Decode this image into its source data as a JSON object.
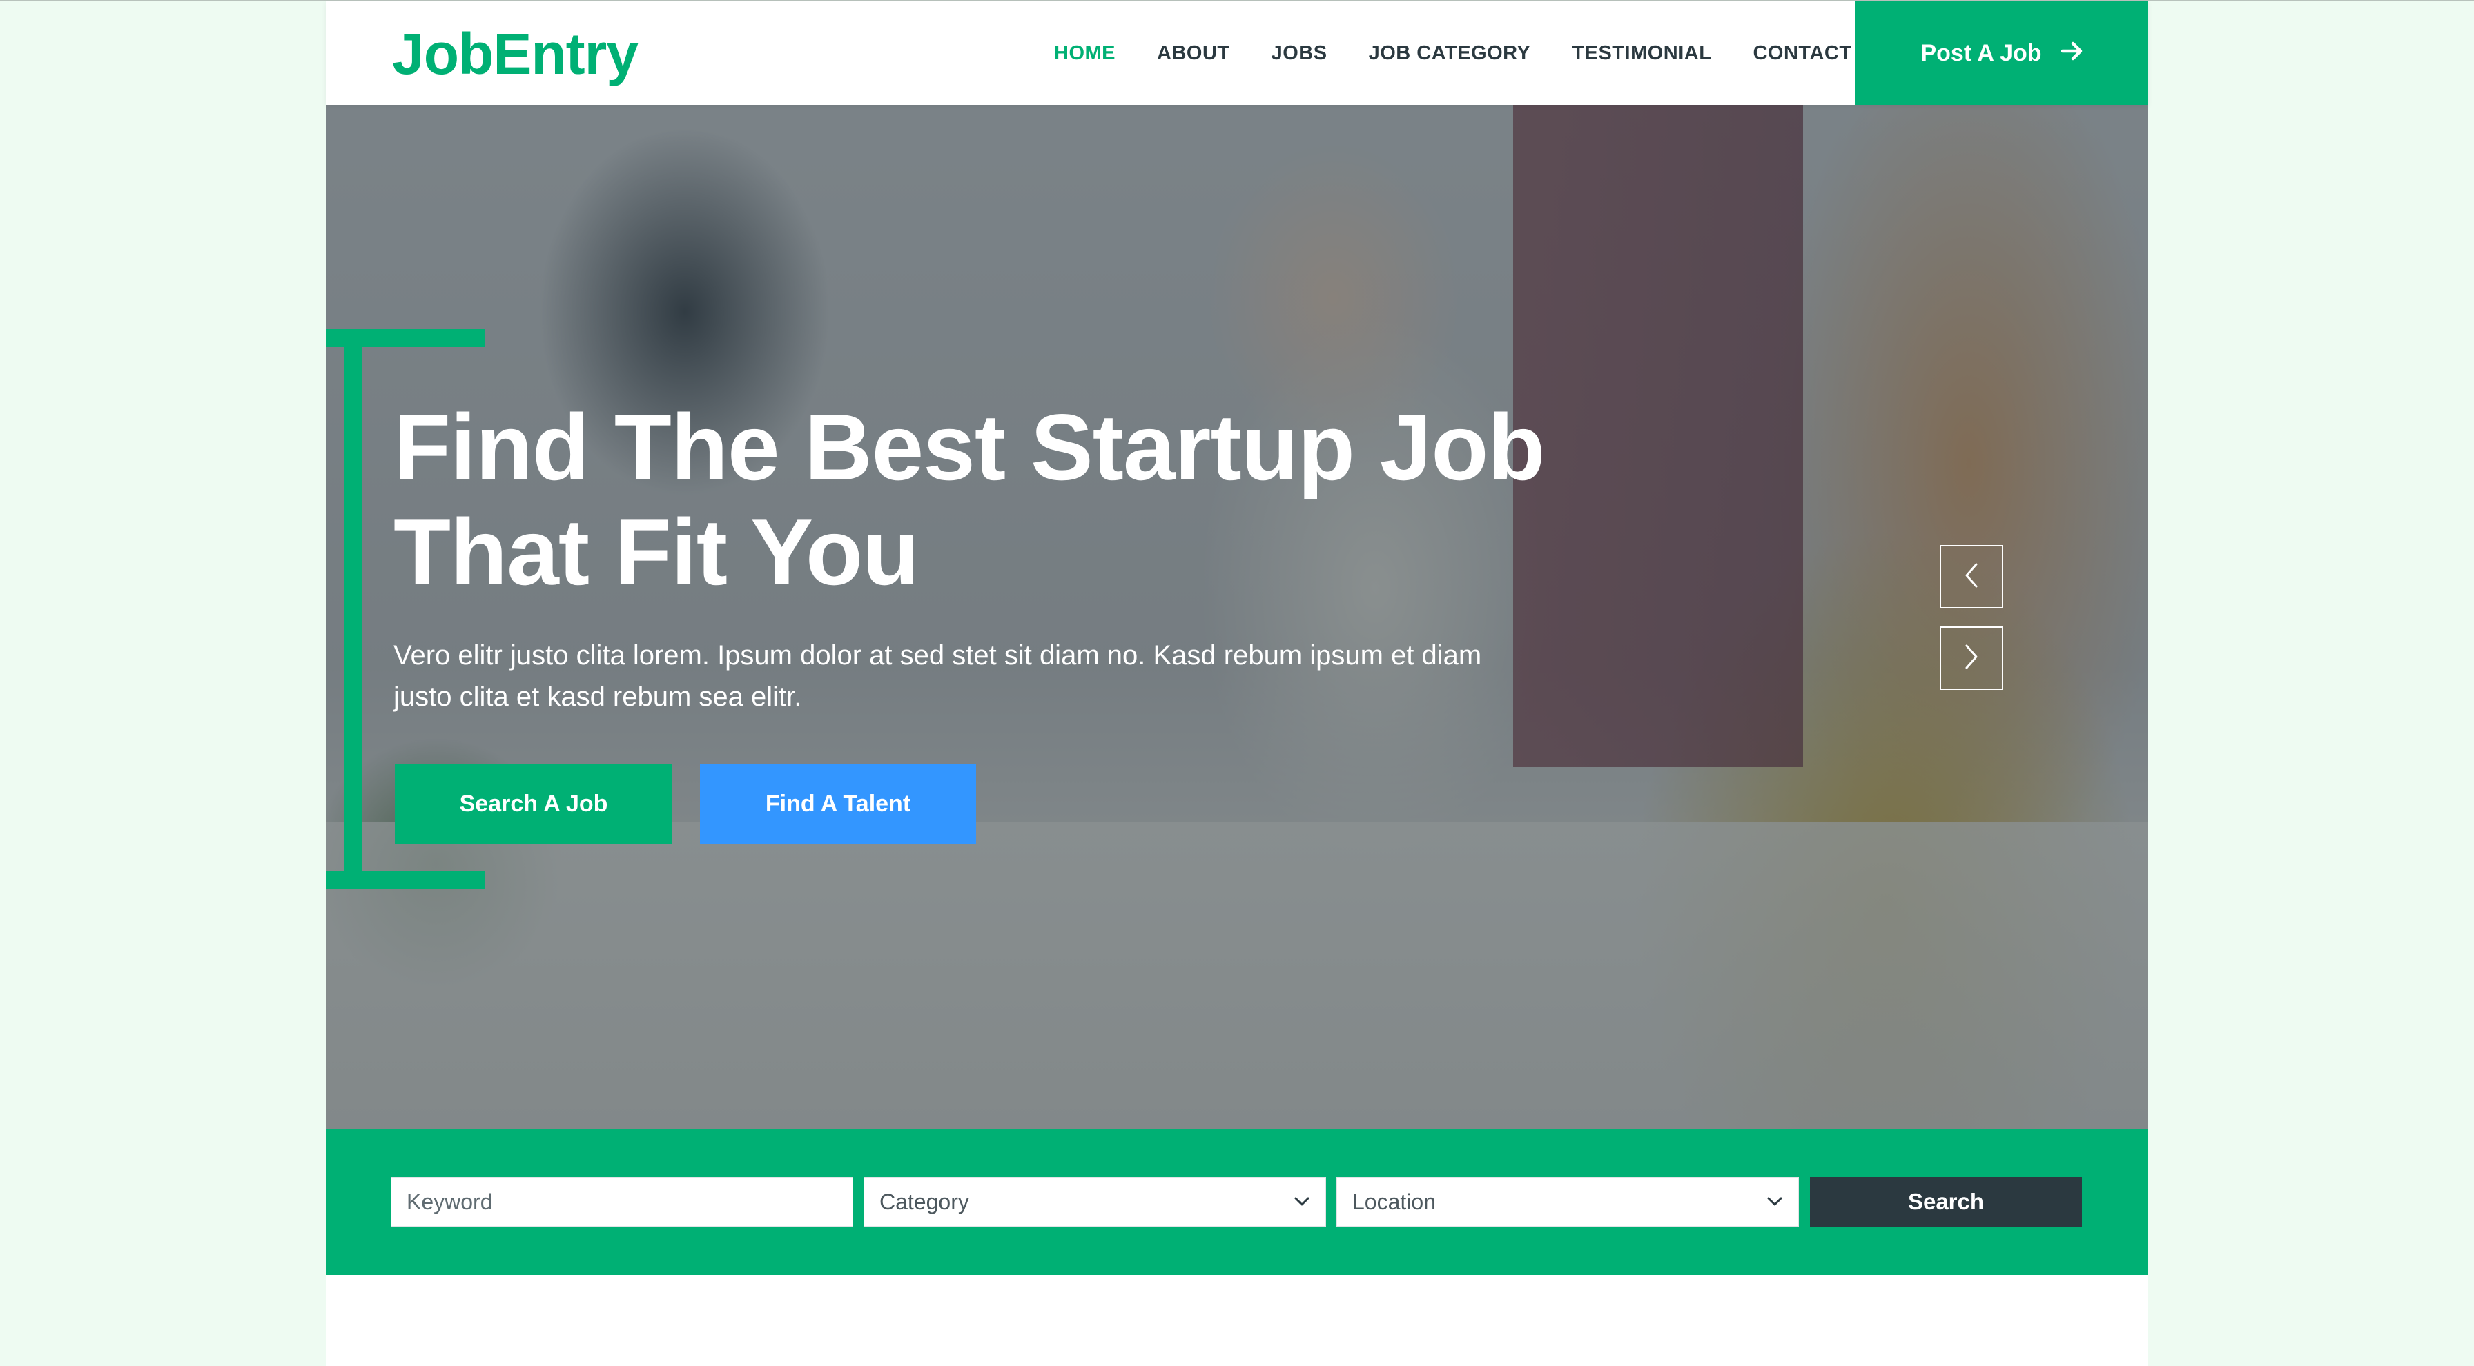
{
  "brand": {
    "name": "JobEntry",
    "color": "#00b074"
  },
  "nav": {
    "items": [
      {
        "label": "HOME",
        "active": true
      },
      {
        "label": "ABOUT",
        "active": false
      },
      {
        "label": "JOBS",
        "active": false
      },
      {
        "label": "JOB CATEGORY",
        "active": false
      },
      {
        "label": "TESTIMONIAL",
        "active": false
      },
      {
        "label": "CONTACT",
        "active": false
      }
    ],
    "post_button": {
      "label": "Post A Job",
      "icon": "arrow-right-icon"
    }
  },
  "hero": {
    "title_line1": "Find The Best Startup Job",
    "title_line2": "That Fit You",
    "text": "Vero elitr justo clita lorem. Ipsum dolor at sed stet sit diam no. Kasd rebum ipsum et diam justo clita et kasd rebum sea elitr.",
    "primary_button": "Search A Job",
    "secondary_button": "Find A Talent",
    "carousel_prev_icon": "chevron-left-icon",
    "carousel_next_icon": "chevron-right-icon"
  },
  "search": {
    "keyword_placeholder": "Keyword",
    "category_value": "Category",
    "location_value": "Location",
    "button_label": "Search"
  },
  "colors": {
    "primary": "#00b074",
    "secondary": "#3396ff",
    "dark": "#2b3940",
    "page_background": "#eefbf2"
  }
}
